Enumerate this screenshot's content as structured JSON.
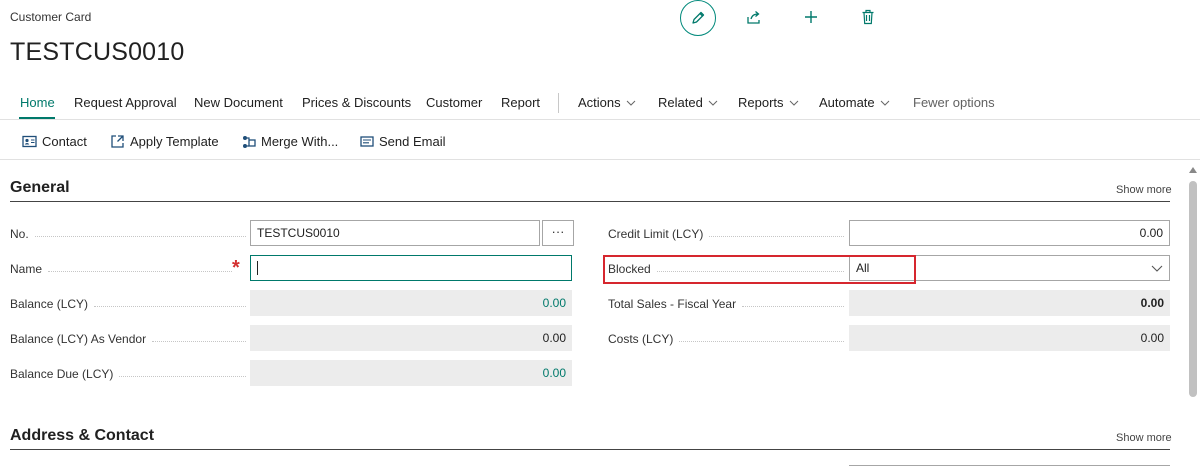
{
  "header": {
    "breadcrumb": "Customer Card",
    "title": "TESTCUS0010",
    "icons": [
      "edit-icon",
      "share-icon",
      "add-icon",
      "delete-icon"
    ]
  },
  "action_bar": {
    "tabs": [
      "Home",
      "Request Approval",
      "New Document",
      "Prices & Discounts",
      "Customer",
      "Report"
    ],
    "active_tab": "Home",
    "menus": [
      "Actions",
      "Related",
      "Reports",
      "Automate"
    ],
    "fewer_options": "Fewer options"
  },
  "commands": [
    {
      "label": "Contact",
      "icon": "contact-card-icon"
    },
    {
      "label": "Apply Template",
      "icon": "apply-template-icon"
    },
    {
      "label": "Merge With...",
      "icon": "merge-icon"
    },
    {
      "label": "Send Email",
      "icon": "email-icon"
    }
  ],
  "general": {
    "title": "General",
    "show_more": "Show more",
    "left_fields": [
      {
        "label": "No.",
        "value": "TESTCUS0010",
        "assist": "···"
      },
      {
        "label": "Name",
        "value": "",
        "required": true
      },
      {
        "label": "Balance (LCY)",
        "value": "0.00"
      },
      {
        "label": "Balance (LCY) As Vendor",
        "value": "0.00"
      },
      {
        "label": "Balance Due (LCY)",
        "value": "0.00"
      }
    ],
    "right_fields": [
      {
        "label": "Credit Limit (LCY)",
        "value": "0.00"
      },
      {
        "label": "Blocked",
        "value": "All"
      },
      {
        "label": "Total Sales - Fiscal Year",
        "value": "0.00"
      },
      {
        "label": "Costs (LCY)",
        "value": "0.00"
      }
    ]
  },
  "address_contact": {
    "title": "Address & Contact",
    "show_more": "Show more"
  },
  "colors": {
    "accent": "#00796b",
    "highlight": "#d6262e",
    "required": "#d32f2f"
  }
}
